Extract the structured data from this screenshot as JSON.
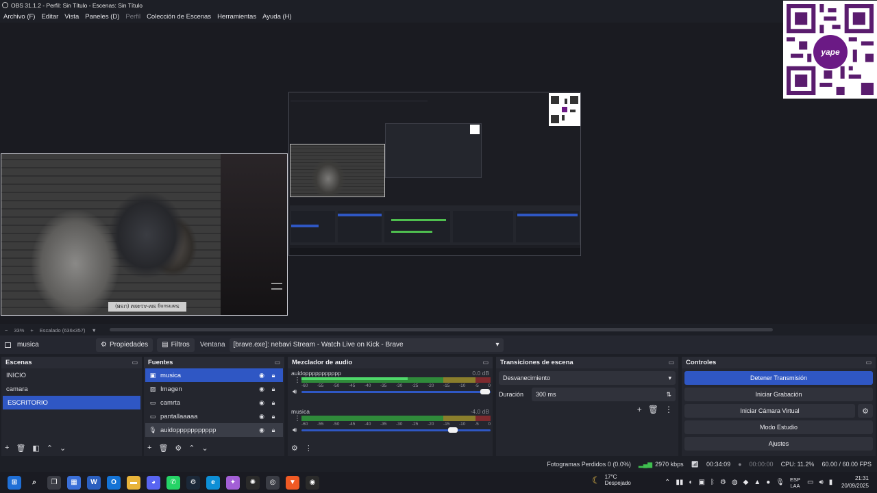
{
  "window": {
    "title": "OBS 31.1.2 - Perfil: Sin Título - Escenas: Sin Título"
  },
  "menu": [
    {
      "label": "Archivo (F)",
      "enabled": true
    },
    {
      "label": "Editar",
      "enabled": true
    },
    {
      "label": "Vista",
      "enabled": true
    },
    {
      "label": "Paneles (D)",
      "enabled": true
    },
    {
      "label": "Perfil",
      "enabled": false
    },
    {
      "label": "Colección de Escenas",
      "enabled": true
    },
    {
      "label": "Herramientas",
      "enabled": true
    },
    {
      "label": "Ayuda (H)",
      "enabled": true
    }
  ],
  "preview": {
    "camera_label": "Samsung SM-A146M (USB)",
    "qr_badge": "yape"
  },
  "zoom": {
    "minus": "−",
    "level": "33%",
    "plus": "+",
    "scaled": "Escalado (636x357)",
    "dropdown": "▼"
  },
  "context": {
    "source": "musica",
    "properties": "Propiedades",
    "filters": "Filtros",
    "window_label": "Ventana",
    "window_value": "[brave.exe]: nebavi Stream - Watch Live on Kick - Brave"
  },
  "scenes": {
    "title": "Escenas",
    "items": [
      "INICIO",
      "camara",
      "ESCRITORIO"
    ],
    "selected": 2
  },
  "sources": {
    "title": "Fuentes",
    "items": [
      {
        "name": "musica",
        "icon": "window-capture-icon",
        "selected": true
      },
      {
        "name": "Imagen",
        "icon": "image-icon",
        "selected": false
      },
      {
        "name": "camrta",
        "icon": "video-capture-icon",
        "selected": false
      },
      {
        "name": "pantallaaaaa",
        "icon": "display-capture-icon",
        "selected": false
      },
      {
        "name": "auidoppppppppppp",
        "icon": "microphone-icon",
        "selected": false,
        "hovered": true
      }
    ]
  },
  "mixer": {
    "title": "Mezclador de audio",
    "channels": [
      {
        "name": "auidoppppppppppp",
        "db": "0.0 dB",
        "level": 0.56,
        "fader": 0.97
      },
      {
        "name": "musica",
        "db": "-4.0 dB",
        "level": 0.0,
        "fader": 0.8
      }
    ],
    "scale": [
      "-60",
      "-55",
      "-50",
      "-45",
      "-40",
      "-35",
      "-30",
      "-25",
      "-20",
      "-15",
      "-10",
      "-5",
      "0"
    ]
  },
  "transitions": {
    "title": "Transiciones de escena",
    "selected": "Desvanecimiento",
    "duration_label": "Duración",
    "duration_value": "300 ms"
  },
  "controls": {
    "title": "Controles",
    "stop_stream": "Detener Transmisión",
    "start_recording": "Iniciar Grabación",
    "start_virtual_cam": "Iniciar Cámara Virtual",
    "studio_mode": "Modo Estudio",
    "settings": "Ajustes"
  },
  "status": {
    "dropped_frames": "Fotogramas Perdidos 0 (0.0%)",
    "bitrate": "2970 kbps",
    "stream_time": "00:34:09",
    "record_time": "00:00:00",
    "cpu": "CPU: 11.2%",
    "fps": "60.00 / 60.00 FPS"
  },
  "taskbar": {
    "weather_temp": "17°C",
    "weather_desc": "Despejado",
    "lang_1": "ESP",
    "lang_2": "LAA",
    "time": "21:31",
    "date": "20/09/2025"
  },
  "colors": {
    "accent": "#2f57c4",
    "panel": "#24262e",
    "background": "#1d1f26"
  }
}
